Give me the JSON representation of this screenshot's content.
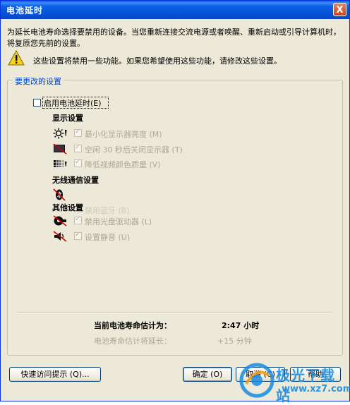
{
  "window": {
    "title": "电池延时",
    "close_glyph": "X"
  },
  "intro": "为延长电池寿命选择要禁用的设备。当您重新连接交流电源或者唤醒、重新启动或引导计算机时，将复原您先前的设置。",
  "warning": "这些设置将禁用一些功能。如果您希望使用这些功能，请修改这些设置。",
  "group_label": "要更改的设置",
  "enable_checkbox": {
    "label": "启用电池延时",
    "hotkey": "(E)",
    "checked": false
  },
  "display": {
    "header": "显示设置",
    "items": [
      {
        "label": "最小化显示器亮度 (M)",
        "icon": "brightness-icon"
      },
      {
        "label": "空闲 30 秒后关闭显示器 (T)",
        "icon": "monitor-off-icon"
      },
      {
        "label": "降低视频颜色质量 (V)",
        "icon": "color-quality-icon"
      }
    ]
  },
  "wireless": {
    "header": "无线通信设置",
    "item_label": "禁用蓝牙 (B)"
  },
  "other": {
    "header": "其他设置",
    "items": [
      {
        "label": "禁用光盘驱动器 (L)",
        "icon": "optical-drive-off-icon"
      },
      {
        "label": "设置静音 (U)",
        "icon": "mute-icon"
      }
    ]
  },
  "estimate": {
    "current_label": "当前电池寿命估计为：",
    "current_value": "2:47 小时",
    "extend_label": "电池寿命估计将延长：",
    "extend_value": "+15 分钟"
  },
  "buttons": {
    "tips": "快速访问提示 (Q)...",
    "ok": "确定 (O)",
    "cancel": "取消 (C)",
    "help": "帮助"
  },
  "watermark": {
    "text": "极光下载站",
    "url": "www.xz7.com"
  },
  "colors": {
    "title_bar": "#0553d8",
    "dialog_bg": "#ece9d8",
    "accent": "#0046d5",
    "disabled_text": "#aca899"
  }
}
